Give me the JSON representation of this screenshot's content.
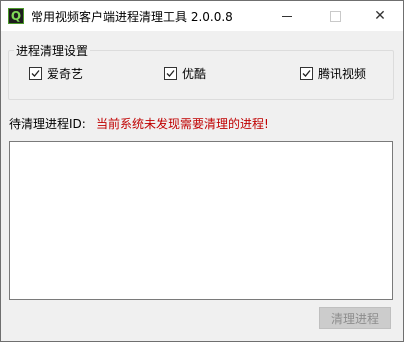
{
  "window": {
    "app_icon_letter": "Q",
    "title": "常用视频客户端进程清理工具 2.0.0.8",
    "controls": {
      "close_glyph": "✕"
    }
  },
  "settings": {
    "group_title": "进程清理设置",
    "options": [
      {
        "label": "爱奇艺",
        "checked": true
      },
      {
        "label": "优酷",
        "checked": true
      },
      {
        "label": "腾讯视频",
        "checked": true
      }
    ]
  },
  "process": {
    "label": "待清理进程ID:",
    "status": "当前系统未发现需要清理的进程!",
    "list_value": ""
  },
  "actions": {
    "clean_label": "清理进程"
  },
  "colors": {
    "status": "#c00000",
    "disabled_button_bg": "#cccccc",
    "disabled_button_text": "#8d8d8d"
  },
  "icons": {
    "app": "app-logo-icon",
    "minimize": "minimize-icon",
    "maximize": "maximize-icon",
    "close": "close-icon",
    "check": "checkmark-icon"
  }
}
